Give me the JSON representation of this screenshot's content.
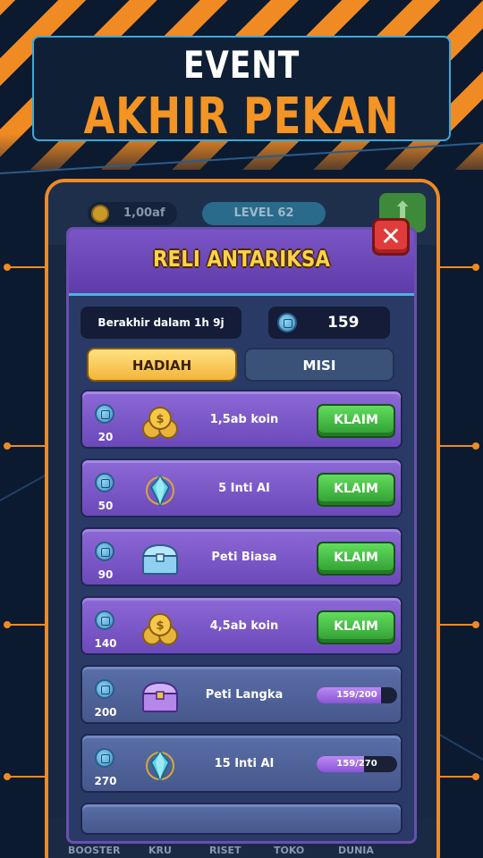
{
  "banner": {
    "line1": "EVENT",
    "line2": "AKHIR PEKAN"
  },
  "game_bar": {
    "coins": "1,00af",
    "level": "LEVEL 62"
  },
  "modal": {
    "title": "RELI ANTARIKSA",
    "ends_text": "Berakhir dalam 1h 9j",
    "token_count": "159",
    "tabs": [
      {
        "label": "HADIAH",
        "selected": true
      },
      {
        "label": "MISI",
        "selected": false
      }
    ],
    "rewards": [
      {
        "cost": "20",
        "label": "1,5ab koin",
        "icon": "coins-icon",
        "state": "claim",
        "button": "KLAIM"
      },
      {
        "cost": "50",
        "label": "5 Inti AI",
        "icon": "ai-core-icon",
        "state": "claim",
        "button": "KLAIM"
      },
      {
        "cost": "90",
        "label": "Peti Biasa",
        "icon": "common-chest-icon",
        "state": "claim",
        "button": "KLAIM"
      },
      {
        "cost": "140",
        "label": "4,5ab koin",
        "icon": "coins-icon",
        "state": "claim",
        "button": "KLAIM"
      },
      {
        "cost": "200",
        "label": "Peti Langka",
        "icon": "rare-chest-icon",
        "state": "progress",
        "progress_text": "159/200",
        "progress": 0.795
      },
      {
        "cost": "270",
        "label": "15 Inti AI",
        "icon": "ai-core-icon",
        "state": "progress",
        "progress_text": "159/270",
        "progress": 0.589
      }
    ]
  },
  "bottom_nav": [
    "BOOSTER",
    "KRU",
    "RISET",
    "TOKO",
    "DUNIA"
  ],
  "colors": {
    "accent_orange": "#f08a22",
    "modal_purple": "#6b49b9",
    "claim_green": "#3cb63a",
    "title_gold": "#ffd24a"
  }
}
